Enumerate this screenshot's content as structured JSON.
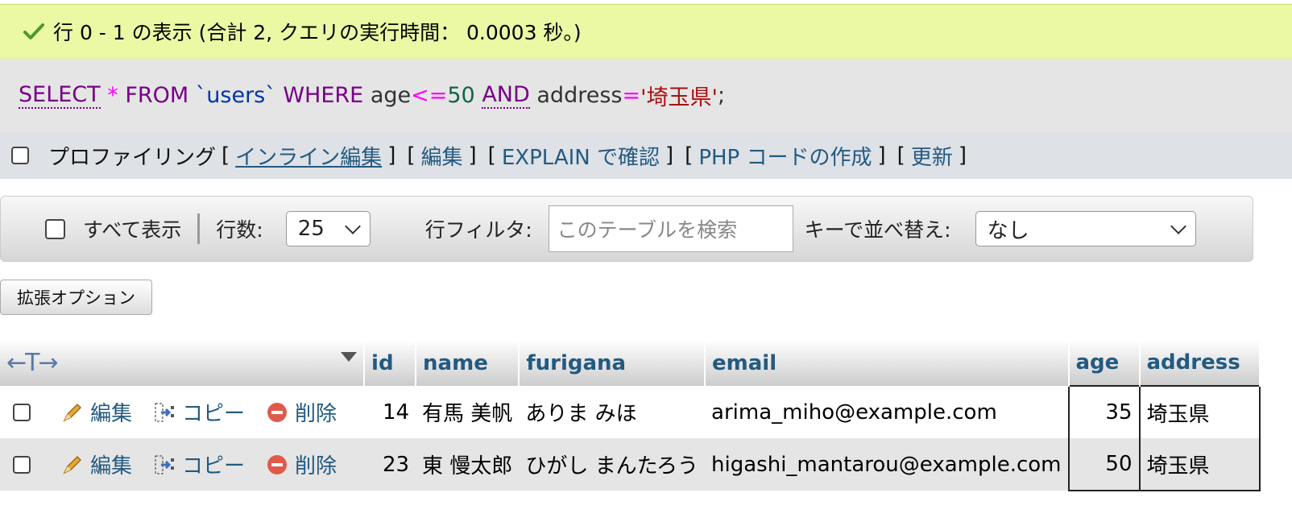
{
  "success": {
    "message": "行 0 - 1 の表示 (合計 2, クエリの実行時間： 0.0003 秒。)"
  },
  "sql": {
    "select": "SELECT",
    "star": "*",
    "from": "FROM",
    "table": "`users`",
    "where": "WHERE",
    "col1": "age",
    "op1": "<=",
    "val1": "50",
    "and": "AND",
    "col2": "address",
    "op2": "=",
    "val2": "'埼玉県'",
    "end": ";"
  },
  "links": {
    "profiling": "プロファイリング",
    "inline_edit": "インライン編集",
    "edit": "編集",
    "explain": "EXPLAIN で確認",
    "php": "PHP コードの作成",
    "refresh": "更新",
    "bracket_open": "[",
    "bracket_close": "]"
  },
  "nav": {
    "show_all": "すべて表示",
    "rows_label": "行数:",
    "rows_value": "25",
    "filter_label": "行フィルタ:",
    "filter_placeholder": "このテーブルを検索",
    "sort_label": "キーで並べ替え:",
    "sort_value": "なし"
  },
  "extended_options": "拡張オプション",
  "table": {
    "arrows": "←T→",
    "columns": [
      "id",
      "name",
      "furigana",
      "email",
      "age",
      "address"
    ],
    "actions": {
      "edit": "編集",
      "copy": "コピー",
      "delete": "削除"
    },
    "rows": [
      {
        "id": "14",
        "name": "有馬 美帆",
        "furigana": "ありま みほ",
        "email": "arima_miho@example.com",
        "age": "35",
        "address": "埼玉県"
      },
      {
        "id": "23",
        "name": "東 慢太郎",
        "furigana": "ひがし まんたろう",
        "email": "higashi_mantarou@example.com",
        "age": "50",
        "address": "埼玉県"
      }
    ]
  },
  "colors": {
    "success_bg": "#ebf8a4",
    "link": "#235a81",
    "sql_keyword": "#770088"
  }
}
